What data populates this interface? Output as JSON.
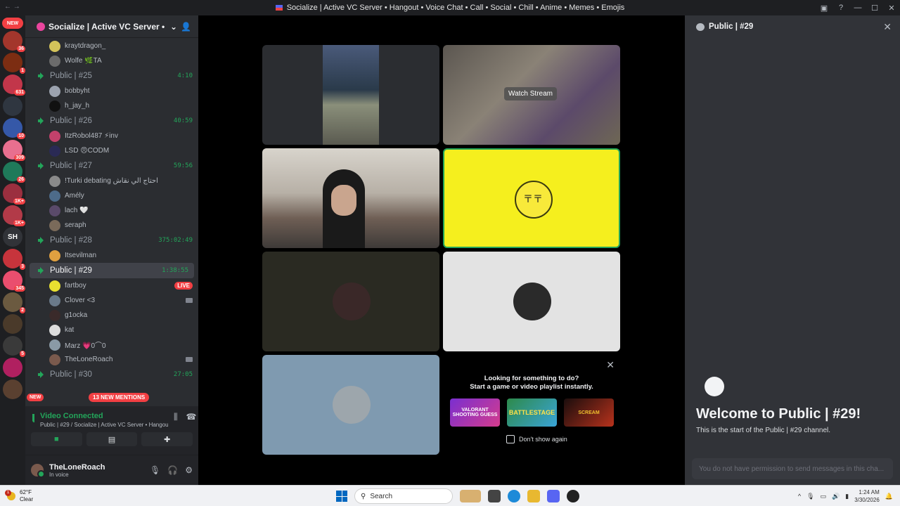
{
  "window": {
    "title": "Socialize | Active VC Server • Hangout • Voice Chat • Call • Social • Chill • Anime • Memes • Emojis"
  },
  "rail": {
    "items": [
      {
        "kind": "new",
        "label": "NEW"
      },
      {
        "kind": "server",
        "color": "#a3362c",
        "badge": "36"
      },
      {
        "kind": "server",
        "color": "#7c2d12",
        "badge": "1"
      },
      {
        "kind": "server",
        "color": "#c2364a",
        "badge": "631"
      },
      {
        "kind": "server",
        "color": "#2f3640",
        "badge": ""
      },
      {
        "kind": "server",
        "color": "#3558a8",
        "badge": "10"
      },
      {
        "kind": "server",
        "color": "#e86f8f",
        "badge": "309"
      },
      {
        "kind": "server",
        "color": "#1f7a5a",
        "badge": "26"
      },
      {
        "kind": "server",
        "color": "#9b2f3f",
        "badge": "1K+"
      },
      {
        "kind": "server",
        "color": "#b23a48",
        "badge": "1K+"
      },
      {
        "kind": "sh",
        "label": "SH"
      },
      {
        "kind": "server",
        "color": "#c7343c",
        "badge": "3"
      },
      {
        "kind": "server",
        "color": "#ea4e6e",
        "badge": "345"
      },
      {
        "kind": "server",
        "color": "#6b5a40",
        "badge": "2"
      },
      {
        "kind": "server",
        "color": "#4a3a2a",
        "badge": ""
      },
      {
        "kind": "server",
        "color": "#3a3a3a",
        "badge": "5"
      },
      {
        "kind": "server",
        "color": "#b02060",
        "badge": ""
      },
      {
        "kind": "server",
        "color": "#5a4030",
        "badge": ""
      }
    ],
    "new_bottom": "NEW"
  },
  "server": {
    "name": "Socialize | Active VC Server • Han...",
    "channels": [
      {
        "type": "member",
        "name": "kraytdragon_",
        "color": "#d4c35a"
      },
      {
        "type": "member",
        "name": "Wolfe 🌿TA",
        "color": "#6b6b6b"
      },
      {
        "type": "voice",
        "name": "Public | #25",
        "time": "4:10"
      },
      {
        "type": "member",
        "name": "bobbyht",
        "color": "#9ca3af"
      },
      {
        "type": "member",
        "name": "h_jay_h",
        "color": "#111111"
      },
      {
        "type": "voice",
        "name": "Public | #26",
        "time": "40:59"
      },
      {
        "type": "member",
        "name": "ItzRobol487 ⚡inv",
        "color": "#c2416b"
      },
      {
        "type": "member",
        "name": "LSD 😠CODM",
        "color": "#2a2a55"
      },
      {
        "type": "voice",
        "name": "Public | #27",
        "time": "59:56"
      },
      {
        "type": "member",
        "name": "!Turki debating احتاج الي نقاش",
        "color": "#8a8a8a"
      },
      {
        "type": "member",
        "name": "Amély",
        "color": "#4d6b8a"
      },
      {
        "type": "member",
        "name": "lach 🤍",
        "color": "#5a4a6a"
      },
      {
        "type": "member",
        "name": "seraph",
        "color": "#7a6a5a"
      },
      {
        "type": "voice",
        "name": "Public | #28",
        "time": "375:02:49"
      },
      {
        "type": "member",
        "name": "Itsevilman",
        "color": "#e0a040"
      },
      {
        "type": "voice",
        "name": "Public | #29",
        "time": "1:38:55",
        "active": true
      },
      {
        "type": "member",
        "name": "fartboy",
        "color": "#e8e030",
        "live": "LIVE"
      },
      {
        "type": "member",
        "name": "Clover <3",
        "color": "#6a7a8a",
        "cam": true
      },
      {
        "type": "member",
        "name": "g1ocka",
        "color": "#3a2a2a"
      },
      {
        "type": "member",
        "name": "kat",
        "color": "#dcdcdc"
      },
      {
        "type": "member",
        "name": "Marz 💗0⌒0",
        "color": "#8a9aa6"
      },
      {
        "type": "member",
        "name": "TheLoneRoach",
        "color": "#7a5a4d",
        "cam": true
      },
      {
        "type": "voice",
        "name": "Public | #30",
        "time": "27:05"
      }
    ],
    "mentions_pill": "13 NEW MENTIONS"
  },
  "voice": {
    "status": "Video Connected",
    "location": "Public | #29 / Socialize | Active VC Server • Hangou..."
  },
  "user": {
    "name": "TheLoneRoach",
    "status": "In voice"
  },
  "stage": {
    "watch_stream": "Watch Stream",
    "activity": {
      "line1": "Looking for something to do?",
      "line2": "Start a game or video playlist instantly.",
      "games": [
        "VALORANT SHOOTING GUESS",
        "BATTLESTAGE",
        "SCREAM"
      ],
      "dont_show": "Don't show again"
    }
  },
  "chat": {
    "title": "Public | #29",
    "welcome": "Welcome to Public | #29!",
    "start": "This is the start of the Public | #29 channel.",
    "input_placeholder": "You do not have permission to send messages in this cha..."
  },
  "taskbar": {
    "temp": "62°F",
    "weather": "Clear",
    "weather_badge": "1",
    "search": "Search",
    "time": "1:24 AM",
    "date": "3/30/2026"
  }
}
